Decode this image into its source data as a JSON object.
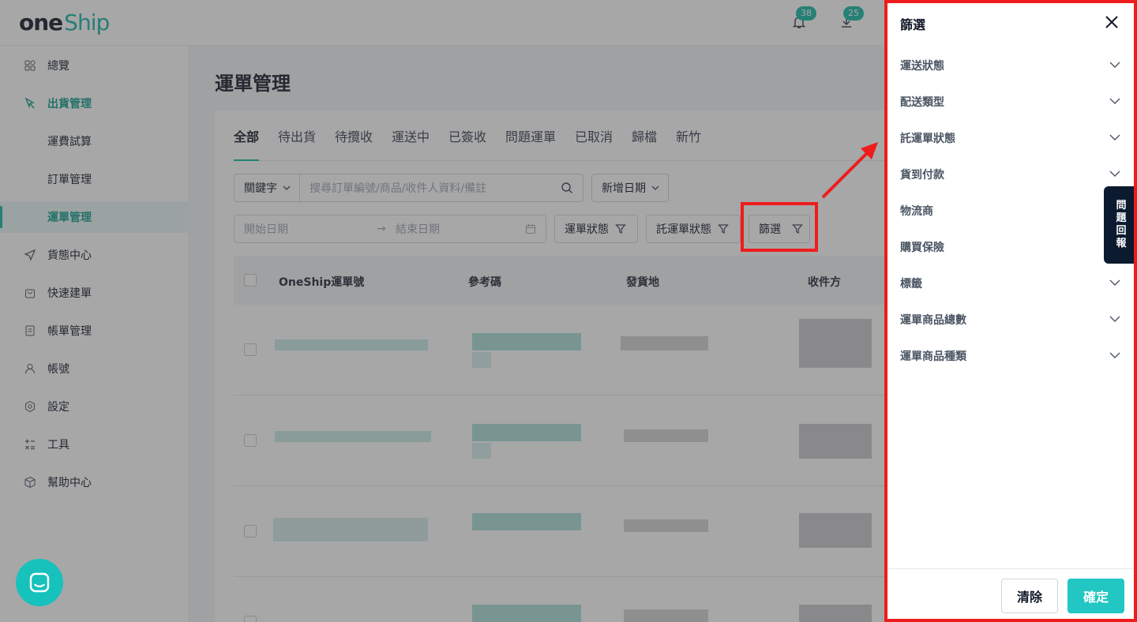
{
  "brand": {
    "logo_one": "one",
    "logo_ship": "Ship"
  },
  "header": {
    "notifications_count": "38",
    "downloads_count": "25"
  },
  "sidebar": {
    "items": [
      {
        "label": "總覽",
        "icon": "dashboard-icon"
      },
      {
        "label": "出貨管理",
        "icon": "shipping-icon"
      },
      {
        "label": "運費試算"
      },
      {
        "label": "訂單管理"
      },
      {
        "label": "運單管理"
      },
      {
        "label": "貨態中心",
        "icon": "send-icon"
      },
      {
        "label": "快速建單",
        "icon": "bag-icon"
      },
      {
        "label": "帳單管理",
        "icon": "bill-icon"
      },
      {
        "label": "帳號",
        "icon": "user-icon"
      },
      {
        "label": "設定",
        "icon": "settings-icon"
      },
      {
        "label": "工具",
        "icon": "calculator-icon"
      },
      {
        "label": "幫助中心",
        "icon": "box-icon"
      }
    ]
  },
  "main": {
    "title": "運單管理",
    "tabs": [
      "全部",
      "待出貨",
      "待攬收",
      "運送中",
      "已簽收",
      "問題運單",
      "已取消",
      "歸檔",
      "新竹"
    ],
    "keyword_select": "關鍵字",
    "search_placeholder": "搜尋訂單編號/商品/收件人資料/備註",
    "date_type_select": "新增日期",
    "start_date_placeholder": "開始日期",
    "end_date_placeholder": "結束日期",
    "filter_buttons": [
      "運單狀態",
      "託運單狀態",
      "篩選"
    ],
    "table_headers": [
      "OneShip運單號",
      "參考碼",
      "發貨地",
      "收件方"
    ]
  },
  "drawer": {
    "title": "篩選",
    "items": [
      {
        "label": "運送狀態",
        "expandable": true
      },
      {
        "label": "配送類型",
        "expandable": true
      },
      {
        "label": "託運單狀態",
        "expandable": true
      },
      {
        "label": "貨到付款",
        "expandable": true
      },
      {
        "label": "物流商",
        "expandable": false
      },
      {
        "label": "購買保險",
        "expandable": false
      },
      {
        "label": "標籤",
        "expandable": true
      },
      {
        "label": "運單商品總數",
        "expandable": true
      },
      {
        "label": "運單商品種類",
        "expandable": true
      }
    ],
    "clear_label": "清除",
    "confirm_label": "確定"
  },
  "feedback_tab": {
    "label": "問題回報",
    "chars": [
      "問",
      "題",
      "回",
      "報"
    ]
  },
  "colors": {
    "accent": "#14b8a6",
    "annotation_red": "#ee1c1c",
    "primary_button": "#22c7c3"
  }
}
